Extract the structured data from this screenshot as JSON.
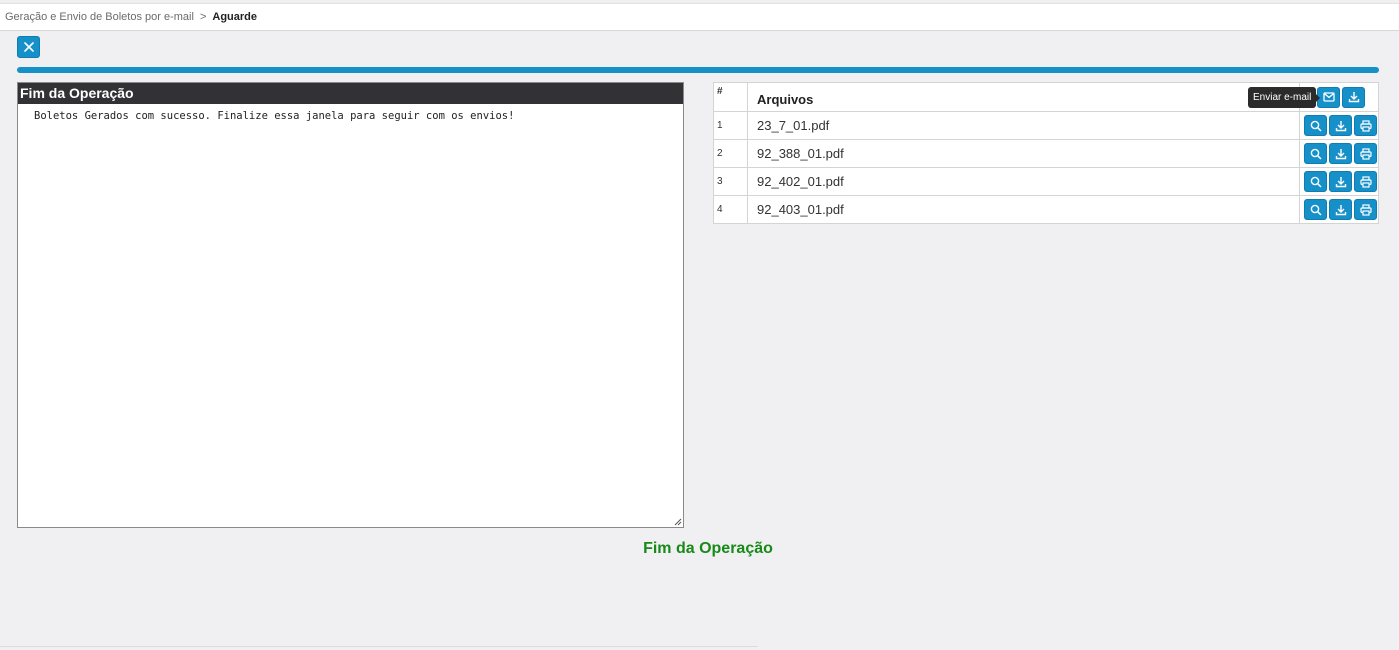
{
  "breadcrumb": {
    "parent": "Geração e Envio de Boletos por e-mail",
    "separator": ">",
    "current": "Aguarde"
  },
  "toolbar": {
    "close_icon": "close-icon"
  },
  "progress": {
    "value_percent": 100,
    "color": "#1590c9"
  },
  "log_panel": {
    "title": "Fim da Operação",
    "text": "Boletos Gerados com sucesso. Finalize essa janela para seguir com os envios!"
  },
  "files_table": {
    "headers": {
      "number": "#",
      "name": "Arquivos"
    },
    "header_actions": [
      "email-icon",
      "download-icon"
    ],
    "rows": [
      {
        "number": "1",
        "name": "23_7_01.pdf"
      },
      {
        "number": "2",
        "name": "92_388_01.pdf"
      },
      {
        "number": "3",
        "name": "92_402_01.pdf"
      },
      {
        "number": "4",
        "name": "92_403_01.pdf"
      }
    ],
    "row_actions": [
      "search-icon",
      "download-icon",
      "print-icon"
    ]
  },
  "tooltip": {
    "text": "Enviar e-mail"
  },
  "status": {
    "text": "Fim da Operação",
    "color": "#178a17"
  },
  "colors": {
    "accent": "#1590c9",
    "header_dark": "#323236"
  }
}
